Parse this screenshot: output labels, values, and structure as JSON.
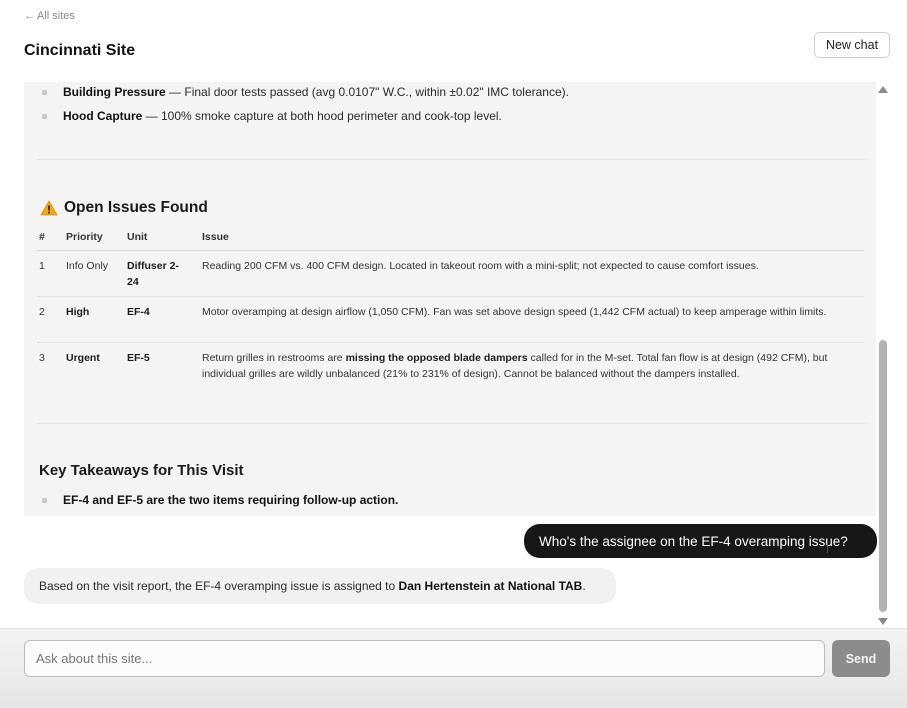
{
  "header": {
    "back_arrow": "←",
    "back_label": "All sites",
    "title": "Cincinnati Site",
    "new_chat_label": "New chat"
  },
  "report": {
    "bullets": [
      {
        "strong": "Building Pressure",
        "rest": " — Final door tests passed (avg 0.0107\" W.C., within ±0.02\" IMC tolerance)."
      },
      {
        "strong": "Hood Capture",
        "rest": " — 100% smoke capture at both hood perimeter and cook-top level."
      }
    ],
    "open_issues": {
      "icon": "warning-icon",
      "title": "Open Issues Found",
      "headers": {
        "num": "#",
        "priority": "Priority",
        "unit": "Unit",
        "issue": "Issue"
      },
      "rows": [
        {
          "num": "1",
          "priority": "Info Only",
          "unit": "Diffuser 2-24",
          "issue": "Reading 200 CFM vs. 400 CFM design. Located in takeout room with a mini-split; not expected to cause comfort issues."
        },
        {
          "num": "2",
          "priority": "High",
          "unit": "EF-4",
          "issue": "Motor overamping at design airflow (1,050 CFM). Fan was set above design speed (1,442 CFM actual) to keep amperage within limits."
        },
        {
          "num": "3",
          "priority": "Urgent",
          "unit": "EF-5",
          "issue_before": "Return grilles in restrooms are ",
          "issue_strong": "missing the opposed blade dampers",
          "issue_after": " called for in the M-set. Total fan flow is at design (492 CFM), but individual grilles are wildly unbalanced (21% to 231% of design). Cannot be balanced without the dampers installed."
        }
      ]
    },
    "takeaways": {
      "title": "Key Takeaways for This Visit",
      "items": [
        "EF-4 and EF-5 are the two items requiring follow-up action."
      ]
    }
  },
  "messages": {
    "user": "Who's the assignee on the EF-4 overamping issue?",
    "assistant_before": "Based on the visit report, the EF-4 overamping issue is assigned to ",
    "assistant_strong": "Dan Hertenstein at National TAB",
    "assistant_after": "."
  },
  "composer": {
    "placeholder": "Ask about this site...",
    "send_label": "Send"
  },
  "colors": {
    "user_bubble": "#171717",
    "report_bg": "#f4f4f4",
    "send_button": "#8c8c8c",
    "warning": "#f2a81d"
  }
}
